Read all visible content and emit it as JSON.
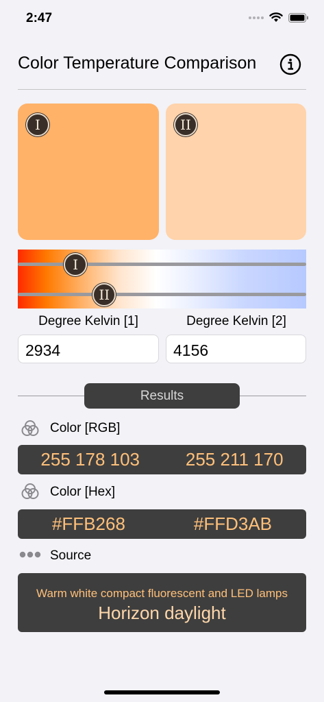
{
  "status": {
    "time": "2:47"
  },
  "header": {
    "title": "Color Temperature Comparison"
  },
  "swatches": [
    {
      "badge": "I",
      "color": "#FFB268"
    },
    {
      "badge": "II",
      "color": "#FFD3AB"
    }
  ],
  "slider": {
    "thumb1_label": "I",
    "thumb2_label": "II",
    "thumb1_level": 0.2,
    "thumb2_level": 0.3
  },
  "kelvin": {
    "label1": "Degree Kelvin [1]",
    "label2": "Degree Kelvin [2]",
    "value1": "2934",
    "value2": "4156"
  },
  "results": {
    "button_label": "Results",
    "rgb": {
      "label": "Color [RGB]",
      "value1": "255 178 103",
      "value2": "255 211 170"
    },
    "hex": {
      "label": "Color [Hex]",
      "value1": "#FFB268",
      "value2": "#FFD3AB"
    },
    "source": {
      "label": "Source",
      "line1": "Warm white compact fluorescent and LED lamps",
      "line2": "Horizon daylight"
    }
  },
  "colors": {
    "panel_bg": "#3E3E3E",
    "accent_text": "#FFC07A",
    "background": "#F2F2F7"
  },
  "icons": [
    "wifi-icon",
    "battery-icon",
    "info-icon",
    "color-circles-icon",
    "ellipsis-icon"
  ]
}
